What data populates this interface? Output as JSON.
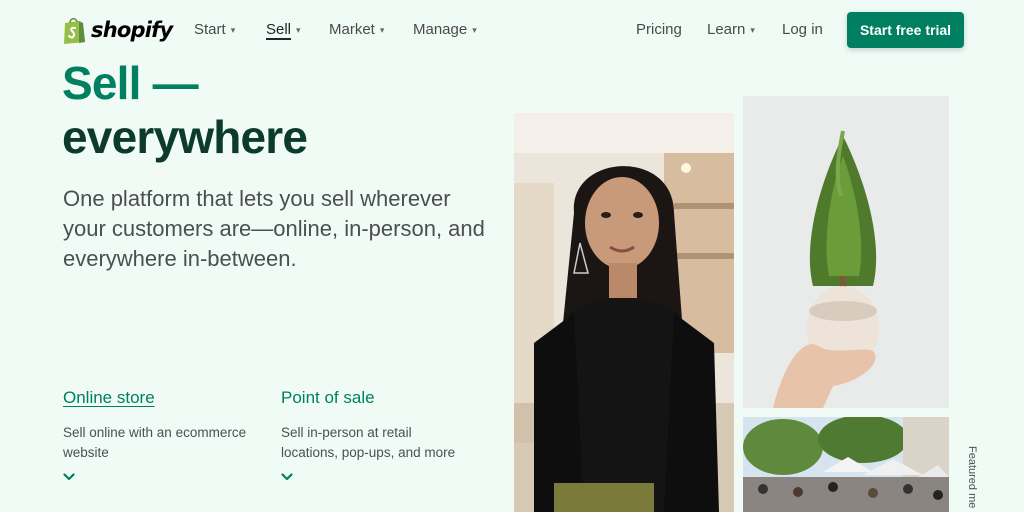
{
  "brand": {
    "name": "shopify",
    "accent": "#008060",
    "dark": "#0c3b2e"
  },
  "nav": {
    "items": [
      {
        "label": "Start",
        "has_dropdown": true
      },
      {
        "label": "Sell",
        "has_dropdown": true,
        "active": true
      },
      {
        "label": "Market",
        "has_dropdown": true
      },
      {
        "label": "Manage",
        "has_dropdown": true
      }
    ],
    "pricing": "Pricing",
    "learn": "Learn",
    "login": "Log in",
    "cta": "Start free trial"
  },
  "hero": {
    "headline_line1": "Sell —",
    "headline_line2": "everywhere",
    "subhead": "One platform that lets you sell wherever your customers are—online, in-person, and everywhere in-between."
  },
  "features": [
    {
      "title": "Online store",
      "desc": "Sell online with an ecommerce website"
    },
    {
      "title": "Point of sale",
      "desc": "Sell in-person at retail locations, pop-ups, and more"
    }
  ],
  "side_label": "Featured me",
  "icons": {
    "logo": "shopping-bag-icon",
    "dropdown": "chevron-down-icon",
    "expand": "chevron-down-icon"
  }
}
